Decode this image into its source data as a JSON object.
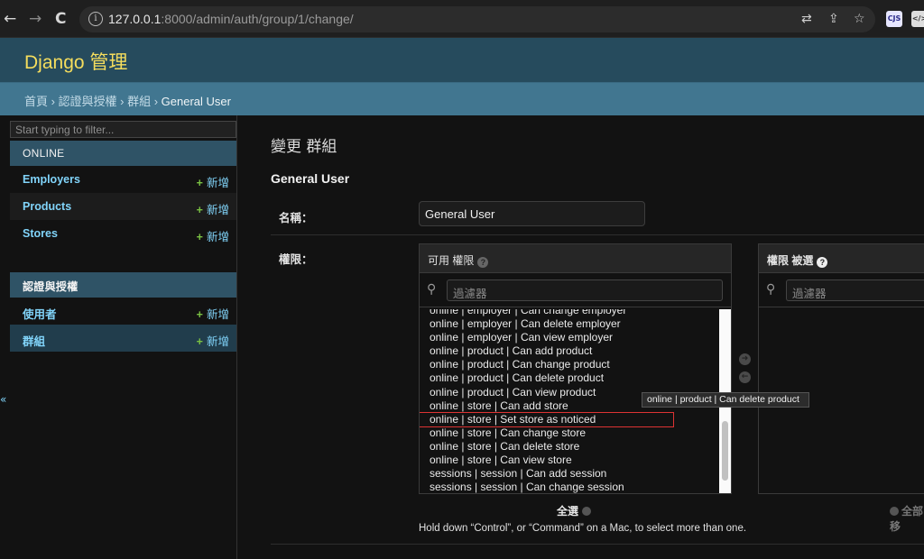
{
  "browser": {
    "back_icon": "←",
    "forward_icon": "→",
    "reload_icon": "C",
    "url_host": "127.0.0.1",
    "url_rest": ":8000/admin/auth/group/1/change/",
    "ext_cjs": "CJS",
    "ext_code": "</>"
  },
  "header": {
    "brand": "Django 管理"
  },
  "breadcrumbs": {
    "text": "首頁 › 認證與授權 › 群組 › ",
    "current": "General User"
  },
  "sidebar": {
    "filter_placeholder": "Start typing to filter...",
    "modules": [
      {
        "caption": "ONLINE",
        "items": [
          {
            "name": "Employers",
            "add": "新增"
          },
          {
            "name": "Products",
            "add": "新增"
          },
          {
            "name": "Stores",
            "add": "新增"
          }
        ]
      },
      {
        "caption": "認證與授權",
        "items": [
          {
            "name": "使用者",
            "add": "新增"
          },
          {
            "name": "群組",
            "add": "新增"
          }
        ]
      }
    ],
    "collapse_icon": "«"
  },
  "content": {
    "page_title": "變更 群組",
    "object_title": "General User",
    "name_label": "名稱：",
    "name_value": "General User",
    "perm_label": "權限："
  },
  "available": {
    "title": "可用 權限",
    "filter_placeholder": "過濾器",
    "options": [
      "online | employer | Can change employer",
      "online | employer | Can delete employer",
      "online | employer | Can view employer",
      "online | product | Can add product",
      "online | product | Can change product",
      "online | product | Can delete product",
      "online | product | Can view product",
      "online | store | Can add store",
      "online | store | Set store as noticed",
      "online | store | Can change store",
      "online | store | Can delete store",
      "online | store | Can view store",
      "sessions | session | Can add session",
      "sessions | session | Can change session"
    ],
    "choose_all": "全選"
  },
  "chosen": {
    "title": "權限 被選",
    "filter_placeholder": "過濾器",
    "remove_all": "全部移"
  },
  "tooltip": "online | product | Can delete product",
  "help_text": "Hold down “Control”, or “Command” on a Mac, to select more than one.",
  "colors": {
    "header": "#264b5d",
    "breadcrumbs": "#417690",
    "brand": "#f5dd5d",
    "link": "#81d4fa",
    "add_plus": "#7ac143"
  }
}
